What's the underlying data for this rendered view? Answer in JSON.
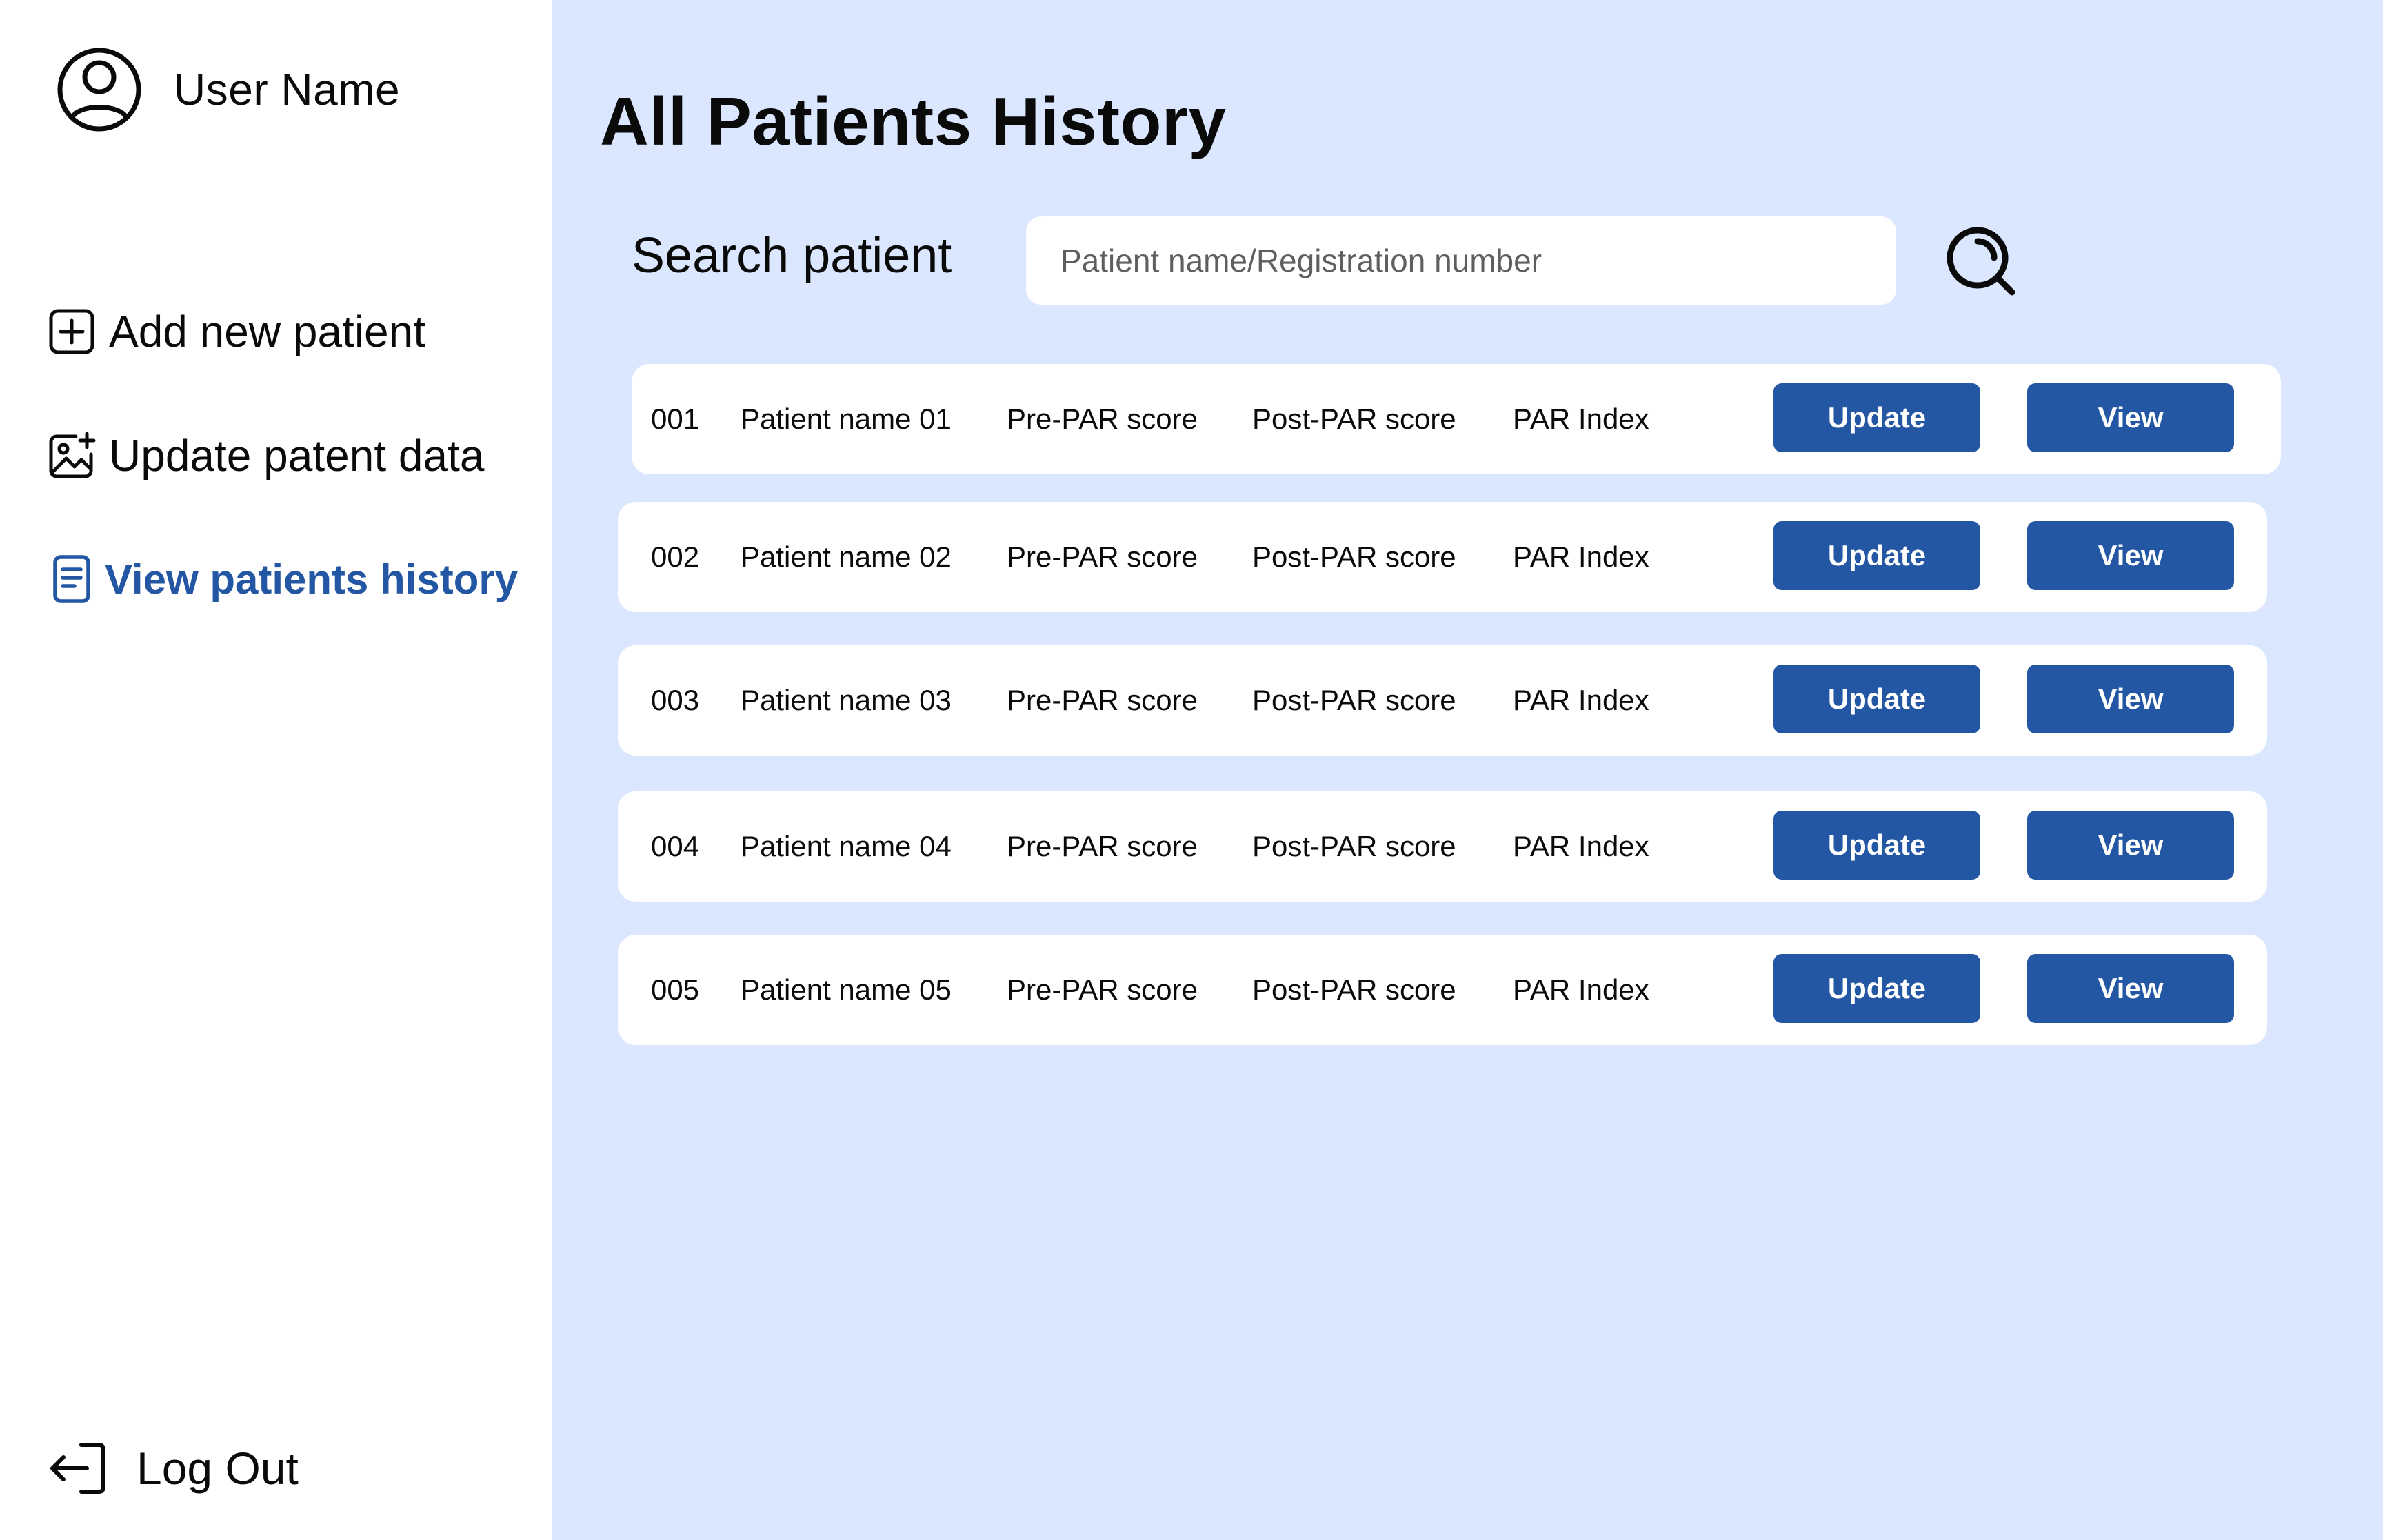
{
  "user": {
    "name": "User Name",
    "avatar_icon": "user-circle-icon"
  },
  "sidebar": {
    "items": [
      {
        "label": "Add new patient",
        "icon": "plus-square-icon",
        "active": false
      },
      {
        "label": "Update patent data",
        "icon": "image-add-icon",
        "active": false
      },
      {
        "label": "View patients history",
        "icon": "document-icon",
        "active": true
      }
    ],
    "logout": {
      "label": "Log Out",
      "icon": "logout-icon"
    }
  },
  "main": {
    "title": "All Patients History",
    "search": {
      "label": "Search patient",
      "placeholder": "Patient name/Registration number",
      "value": "",
      "button_icon": "search-icon"
    },
    "patients": [
      {
        "id": "001",
        "name": "Patient name 01",
        "pre_par": "Pre-PAR score",
        "post_par": "Post-PAR score",
        "par_index": "PAR Index",
        "update_label": "Update",
        "view_label": "View"
      },
      {
        "id": "002",
        "name": "Patient name 02",
        "pre_par": "Pre-PAR score",
        "post_par": "Post-PAR score",
        "par_index": "PAR Index",
        "update_label": "Update",
        "view_label": "View"
      },
      {
        "id": "003",
        "name": "Patient name 03",
        "pre_par": "Pre-PAR score",
        "post_par": "Post-PAR score",
        "par_index": "PAR Index",
        "update_label": "Update",
        "view_label": "View"
      },
      {
        "id": "004",
        "name": "Patient name 04",
        "pre_par": "Pre-PAR score",
        "post_par": "Post-PAR score",
        "par_index": "PAR Index",
        "update_label": "Update",
        "view_label": "View"
      },
      {
        "id": "005",
        "name": "Patient name 05",
        "pre_par": "Pre-PAR score",
        "post_par": "Post-PAR score",
        "par_index": "PAR Index",
        "update_label": "Update",
        "view_label": "View"
      }
    ]
  },
  "colors": {
    "accent": "#2356a3",
    "main_background": "#dbe7fe",
    "card_background": "#ffffff"
  }
}
